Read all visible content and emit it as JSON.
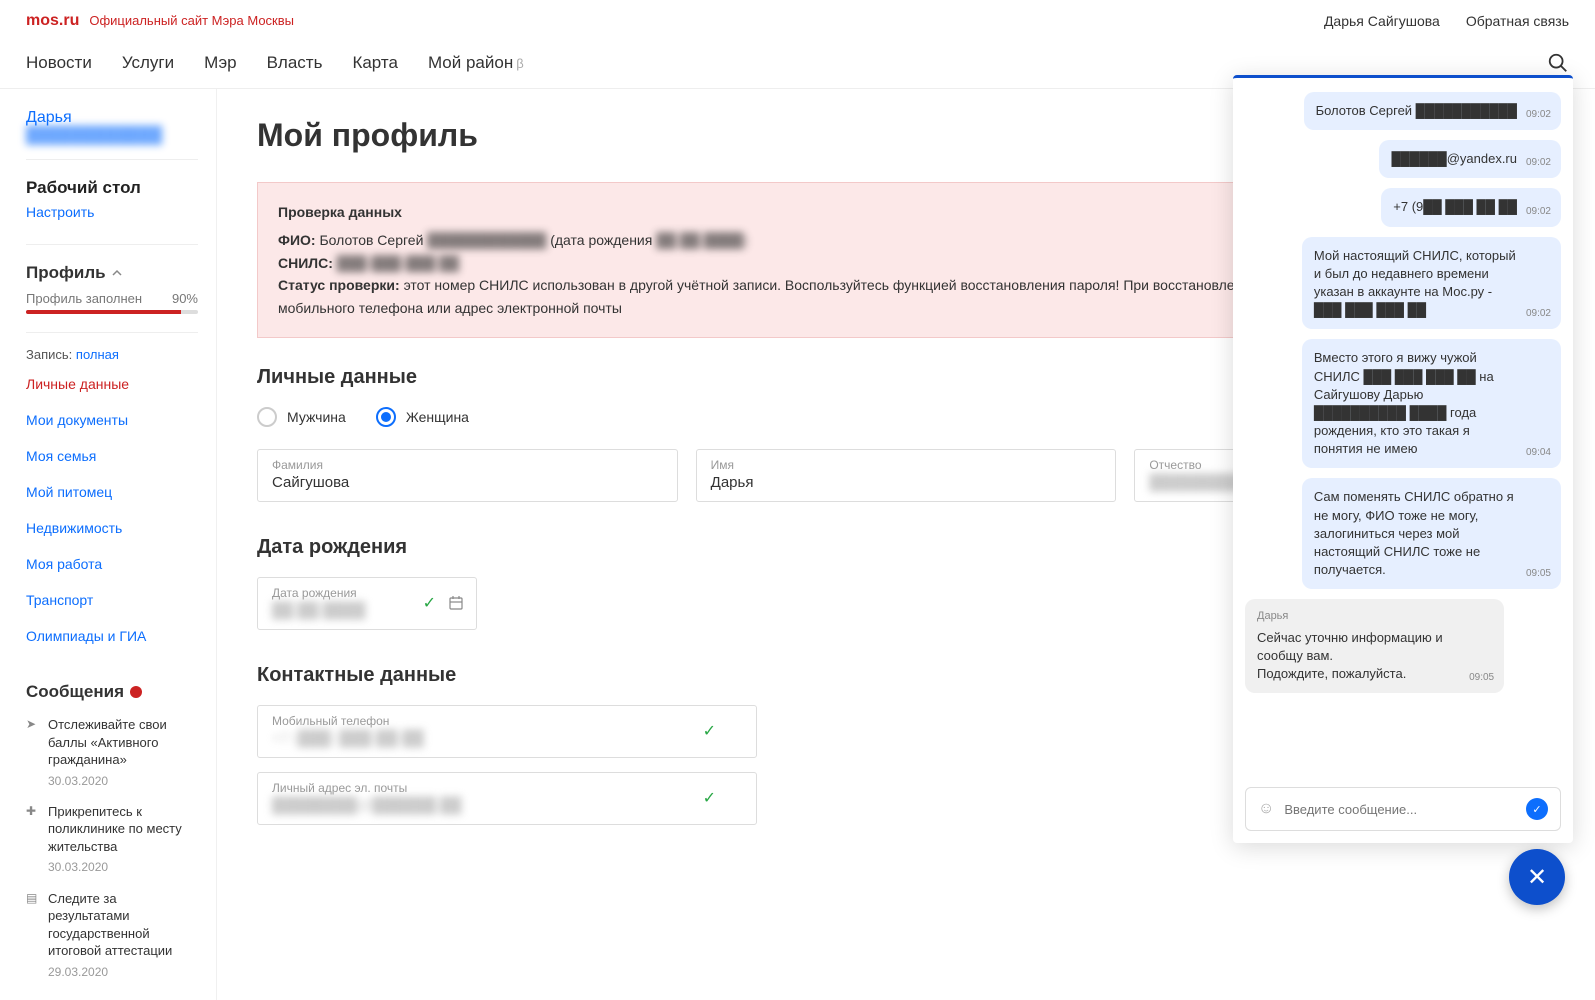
{
  "topbar": {
    "logo": "mos.ru",
    "logo_sub": "Официальный сайт Мэра Москвы",
    "user": "Дарья Сайгушова",
    "feedback": "Обратная связь"
  },
  "nav": {
    "items": [
      "Новости",
      "Услуги",
      "Мэр",
      "Власть",
      "Карта",
      "Мой район"
    ],
    "beta": "β"
  },
  "sidebar": {
    "user_first": "Дарья",
    "user_last_blur": "████████████",
    "desktop": {
      "title": "Рабочий стол",
      "configure": "Настроить"
    },
    "profile": {
      "title": "Профиль",
      "filled_label": "Профиль заполнен",
      "filled_pct": "90%",
      "record_label": "Запись:",
      "record_value": "полная",
      "links": [
        "Личные данные",
        "Мои документы",
        "Моя семья",
        "Мой питомец",
        "Недвижимость",
        "Моя работа",
        "Транспорт",
        "Олимпиады и ГИА"
      ]
    },
    "messages": {
      "title": "Сообщения",
      "items": [
        {
          "text": "Отслеживайте свои баллы «Активного гражданина»",
          "date": "30.03.2020"
        },
        {
          "text": "Прикрепитесь к поликлинике по месту жительства",
          "date": "30.03.2020"
        },
        {
          "text": "Следите за результатами государственной итоговой аттестации",
          "date": "29.03.2020"
        }
      ]
    }
  },
  "main": {
    "title": "Мой профиль",
    "alert": {
      "title": "Проверка данных",
      "fio_label": "ФИО:",
      "fio_value": "Болотов Сергей",
      "fio_blur": "████████████",
      "dob_label": "(дата рождения",
      "dob_blur": "██.██.████)",
      "snils_label": "СНИЛС:",
      "snils_blur": "███-███-███ ██",
      "status_label": "Статус проверки:",
      "status_text": "этот номер СНИЛС использован в другой учётной записи. Воспользуйтесь функцией восстановления пароля! При восстановлении необходимо использовать номер мобильного телефона или адрес электронной почты"
    },
    "personal": {
      "title": "Личные данные",
      "male": "Мужчина",
      "female": "Женщина",
      "lastname_label": "Фамилия",
      "lastname": "Сайгушова",
      "firstname_label": "Имя",
      "firstname": "Дарья",
      "patronymic_label": "Отчество",
      "patronymic_blur": "████████████"
    },
    "dob": {
      "title": "Дата рождения",
      "label": "Дата рождения",
      "value_blur": "██.██.████"
    },
    "contact": {
      "title": "Контактные данные",
      "phone_label": "Мобильный телефон",
      "phone_blur": "+7 (███) ███-██-██",
      "email_label": "Личный адрес эл. почты",
      "email_blur": "████████@██████.██"
    }
  },
  "chat": {
    "messages": [
      {
        "side": "right",
        "text": "Болотов Сергей ███████████",
        "time": "09:02"
      },
      {
        "side": "right",
        "text": "██████@yandex.ru",
        "time": "09:02"
      },
      {
        "side": "right",
        "text": "+7 (9██ ███ ██ ██",
        "time": "09:02"
      },
      {
        "side": "right",
        "text": "Мой настоящий СНИЛС, который и был до недавнего времени указан в аккаунте на Мос.ру - ███ ███ ███ ██",
        "time": "09:02"
      },
      {
        "side": "right",
        "text": "Вместо этого я вижу чужой СНИЛС ███ ███ ███ ██ на Сайгушову Дарью ██████████ ████ года рождения, кто это такая я понятия не имею",
        "time": "09:04"
      },
      {
        "side": "right",
        "text": "Сам поменять СНИЛС обратно я не могу, ФИО тоже не могу, залогиниться через мой настоящий СНИЛС тоже не получается.",
        "time": "09:05"
      },
      {
        "side": "left",
        "name": "Дарья",
        "text": "Сейчас уточню информацию и сообщу вам.\nПодождите, пожалуйста.",
        "time": "09:05"
      }
    ],
    "input_placeholder": "Введите сообщение..."
  }
}
